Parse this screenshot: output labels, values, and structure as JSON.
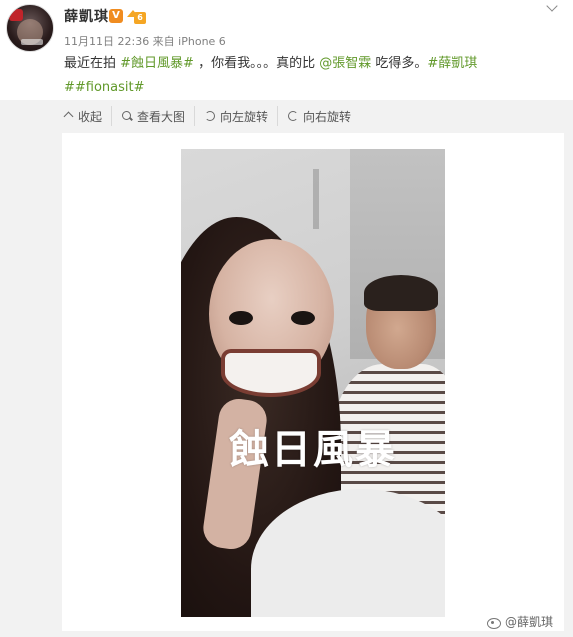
{
  "post": {
    "username": "薛凱琪",
    "verified_badge": "V",
    "member_badge": "6",
    "meta": "11月11日 22:36 来自 iPhone 6",
    "content": {
      "intro": "最近在拍 ",
      "tag1": "#蝕日風暴#",
      "mid": " ，你看我。。。真的比 ",
      "mention": "@張智霖",
      "tail": " 吃得多。",
      "tag2": "#薛凱琪",
      "tag3": "##fionasit#"
    }
  },
  "toolbar": {
    "collapse": "收起",
    "view_large": "查看大图",
    "rotate_left": "向左旋转",
    "rotate_right": "向右旋转"
  },
  "photo": {
    "overlay_text": "蝕日風暴"
  },
  "watermark": {
    "text": "@薛凱琪"
  },
  "icons": [
    "chevron-down-icon",
    "collapse-icon",
    "zoom-icon",
    "rotate-left-icon",
    "rotate-right-icon",
    "weibo-logo-icon"
  ]
}
